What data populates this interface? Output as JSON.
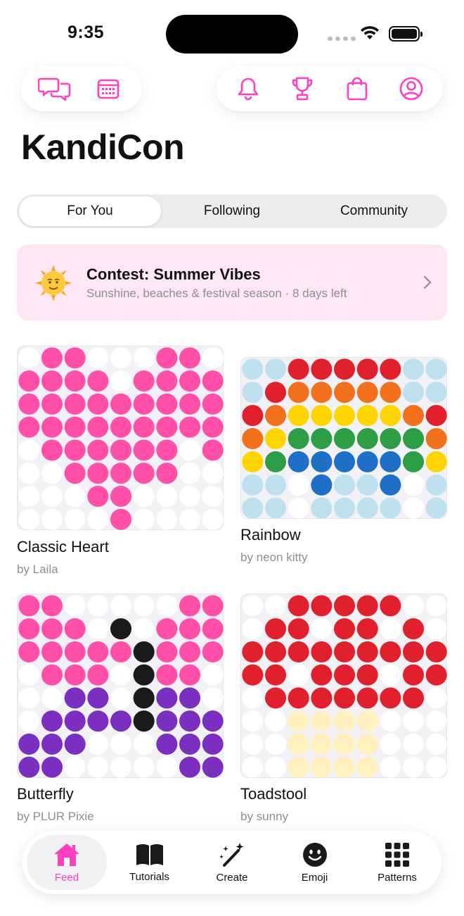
{
  "status": {
    "time": "9:35"
  },
  "colors": {
    "accent": "#ff3fc0",
    "pink": "#ff4fa8",
    "white_bead": "#ffffff",
    "red": "#e0202c",
    "orange": "#f2711c",
    "yellow": "#ffd400",
    "green": "#2e9e46",
    "blue": "#1f6fc7",
    "light_blue": "#bfe0ef",
    "purple": "#7b2fbe",
    "black": "#1a1a1a",
    "cream": "#fff0bd"
  },
  "top_left_icons": [
    "chat-icon",
    "calendar-icon"
  ],
  "top_right_icons": [
    "bell-icon",
    "trophy-icon",
    "shopping-bag-icon",
    "profile-icon"
  ],
  "title": "KandiCon",
  "tabs": [
    {
      "label": "For You",
      "active": true
    },
    {
      "label": "Following",
      "active": false
    },
    {
      "label": "Community",
      "active": false
    }
  ],
  "contest": {
    "emoji": "sun-face-icon",
    "title": "Contest: Summer Vibes",
    "subtitle": "Sunshine, beaches & festival season · 8 days left"
  },
  "patterns": [
    {
      "title": "Classic Heart",
      "author": "by Laila",
      "palette": {
        "w": "white_bead",
        "p": "pink"
      },
      "rows": [
        "wppwwwppw",
        "ppppwpppp",
        "ppppppppp",
        "ppppppppp",
        "wppppppwp",
        "wwpppppww",
        "wwwppwwww",
        "wwwwpwwww"
      ]
    },
    {
      "title": "Rainbow",
      "author": "by neon kitty",
      "palette": {
        "l": "light_blue",
        "r": "red",
        "o": "orange",
        "y": "yellow",
        "g": "green",
        "b": "blue",
        "w": "white_bead"
      },
      "rows": [
        "llrrrrrll",
        "lroooooll",
        "royyyyyor",
        "oyggggggo",
        "ygbbbbbgy",
        "llwbllbwl",
        "llwllllwl"
      ]
    },
    {
      "title": "Butterfly",
      "author": "by PLUR Pixie",
      "palette": {
        "w": "white_bead",
        "p": "pink",
        "k": "black",
        "v": "purple"
      },
      "rows": [
        "ppwwwwwpp",
        "pppwkwppp",
        "pppppkppp",
        "wpppwkppw",
        "wwvvwkvvw",
        "wvvvvkvvv",
        "vvvwwwvvv",
        "vvwwwwwvv"
      ]
    },
    {
      "title": "Toadstool",
      "author": "by sunny",
      "palette": {
        "w": "white_bead",
        "r": "red",
        "c": "cream"
      },
      "rows": [
        "wwrrrrrww",
        "wrrwrrwrw",
        "rrrrrrrrr",
        "rrwrrrwrr",
        "wrrrrrrrw",
        "wwccccwww",
        "wwccccwww",
        "wwccccwww"
      ]
    }
  ],
  "tab_bar": [
    {
      "label": "Feed",
      "icon": "house-icon",
      "active": true
    },
    {
      "label": "Tutorials",
      "icon": "book-icon",
      "active": false
    },
    {
      "label": "Create",
      "icon": "magic-wand-icon",
      "active": false
    },
    {
      "label": "Emoji",
      "icon": "smiley-icon",
      "active": false
    },
    {
      "label": "Patterns",
      "icon": "grid-icon",
      "active": false
    }
  ]
}
